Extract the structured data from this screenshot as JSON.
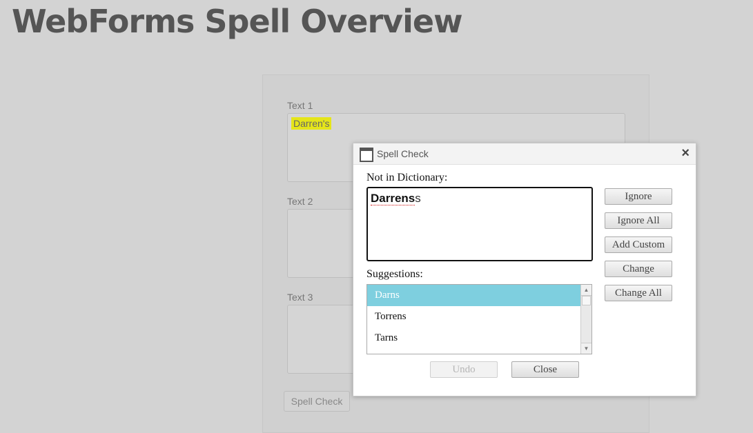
{
  "page": {
    "title": "WebForms Spell Overview"
  },
  "form": {
    "fields": [
      {
        "label": "Text 1",
        "value": "Darren's"
      },
      {
        "label": "Text 2",
        "value": ""
      },
      {
        "label": "Text 3",
        "value": ""
      }
    ],
    "spell_check_button": "Spell Check",
    "highlight_color": "#e5e51a"
  },
  "dialog": {
    "title": "Spell Check",
    "close_icon": "close-icon",
    "not_in_dictionary_label": "Not in Dictionary:",
    "word_bold": "Darrens",
    "word_rest": "s",
    "suggestions_label": "Suggestions:",
    "suggestions": [
      "Darns",
      "Torrens",
      "Tarns"
    ],
    "selected_suggestion": "Darns",
    "buttons": {
      "ignore": "Ignore",
      "ignore_all": "Ignore All",
      "add_custom": "Add Custom",
      "change": "Change",
      "change_all": "Change All",
      "undo": "Undo",
      "close": "Close"
    },
    "selection_color": "#7ecfdf"
  }
}
